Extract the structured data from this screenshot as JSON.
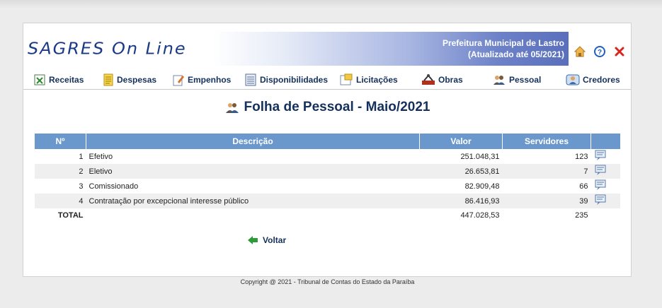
{
  "header": {
    "logo": "SAGRES On Line",
    "org": "Prefeitura Municipal de Lastro",
    "updated": "(Atualizado até 05/2021)"
  },
  "menu": [
    {
      "label": "Receitas",
      "icon": "spreadsheet-icon"
    },
    {
      "label": "Despesas",
      "icon": "notepad-icon"
    },
    {
      "label": "Empenhos",
      "icon": "pencil-document-icon"
    },
    {
      "label": "Disponibilidades",
      "icon": "ledger-icon"
    },
    {
      "label": "Licitações",
      "icon": "folder-icon"
    },
    {
      "label": "Obras",
      "icon": "construction-icon"
    },
    {
      "label": "Pessoal",
      "icon": "people-icon"
    },
    {
      "label": "Credores",
      "icon": "user-card-icon"
    }
  ],
  "page_title": "Folha de Pessoal - Maio/2021",
  "table": {
    "headers": [
      "Nº",
      "Descrição",
      "Valor",
      "Servidores"
    ],
    "rows": [
      {
        "n": "1",
        "descricao": "Efetivo",
        "valor": "251.048,31",
        "servidores": "123"
      },
      {
        "n": "2",
        "descricao": "Eletivo",
        "valor": "26.653,81",
        "servidores": "7"
      },
      {
        "n": "3",
        "descricao": "Comissionado",
        "valor": "82.909,48",
        "servidores": "66"
      },
      {
        "n": "4",
        "descricao": "Contratação por excepcional interesse público",
        "valor": "86.416,93",
        "servidores": "39"
      }
    ],
    "total": {
      "label": "TOTAL",
      "valor": "447.028,53",
      "servidores": "235"
    }
  },
  "voltar": "Voltar",
  "copyright": "Copyright @ 2021 - Tribunal de Contas do Estado da Paraíba",
  "colors": {
    "header_bg": "#6a98cc",
    "title": "#14305c",
    "logo": "#1a3a86"
  }
}
